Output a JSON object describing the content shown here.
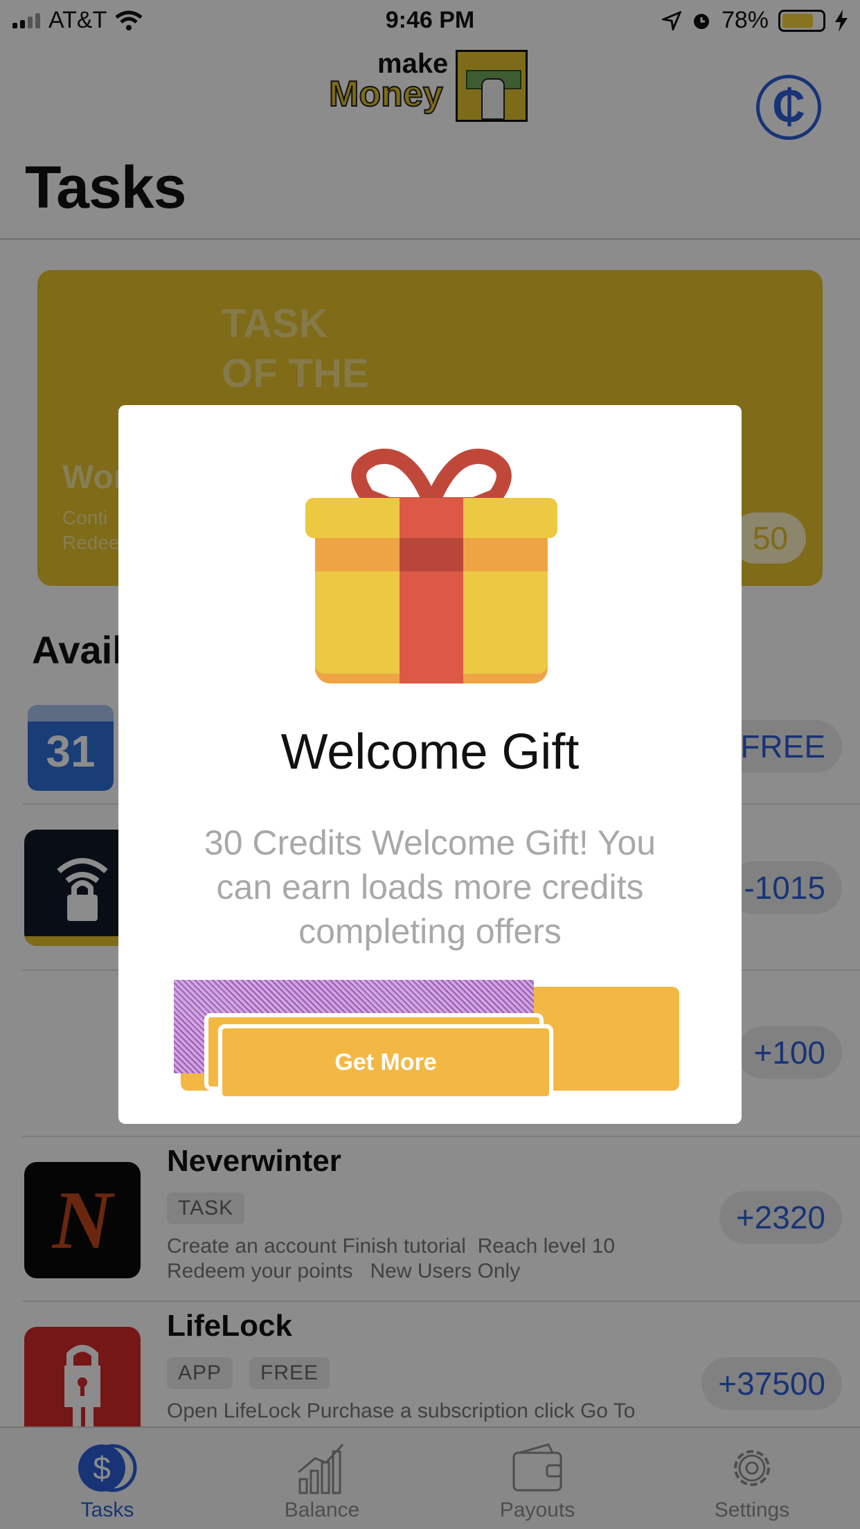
{
  "status_bar": {
    "carrier": "AT&T",
    "time": "9:46 PM",
    "battery": "78%",
    "battery_level": 0.78
  },
  "header": {
    "logo_small": "make",
    "logo_large": "Money"
  },
  "page_title": "Tasks",
  "task_of_the_day": {
    "kicker_line1": "TASK",
    "kicker_line2": "OF THE",
    "name": "Wor",
    "desc_line1": "Conti",
    "desc_line2": "Redee",
    "reward": "50"
  },
  "section_title": "Avail",
  "tasks": [
    {
      "name": "",
      "tags": [],
      "desc": "",
      "reward": "0 FREE",
      "icon": "calendar-icon",
      "icon_text": "31"
    },
    {
      "name": "",
      "tags": [],
      "desc": "",
      "reward": "-1015",
      "icon": "wifi-lock-icon"
    },
    {
      "name": "",
      "tags": [],
      "desc": "",
      "reward": "+100",
      "icon": ""
    },
    {
      "name": "Neverwinter",
      "tags": [
        "TASK"
      ],
      "desc": "Create an account Finish tutorial  Reach level 10\nRedeem your points   New Users Only",
      "reward": "+2320",
      "icon": "neverwinter-icon",
      "icon_text": "N"
    },
    {
      "name": "LifeLock",
      "tags": [
        "APP",
        "FREE"
      ],
      "desc": "Open LifeLock Purchase a subscription click Go To",
      "reward": "+37500",
      "icon": "lifelock-icon"
    }
  ],
  "tabs": [
    {
      "label": "Tasks",
      "icon": "dollar-coin-icon",
      "active": true
    },
    {
      "label": "Balance",
      "icon": "bar-chart-icon",
      "active": false
    },
    {
      "label": "Payouts",
      "icon": "wallet-icon",
      "active": false
    },
    {
      "label": "Settings",
      "icon": "gear-icon",
      "active": false
    }
  ],
  "modal": {
    "title": "Welcome Gift",
    "body": "30 Credits Welcome Gift! You can earn loads more credits completing offers",
    "button": "Get More"
  },
  "colors": {
    "accent_blue": "#2d5fd9",
    "card_yellow": "#e7c32c",
    "button_orange": "#f3b844",
    "ribbon_red": "#dc5a45"
  }
}
